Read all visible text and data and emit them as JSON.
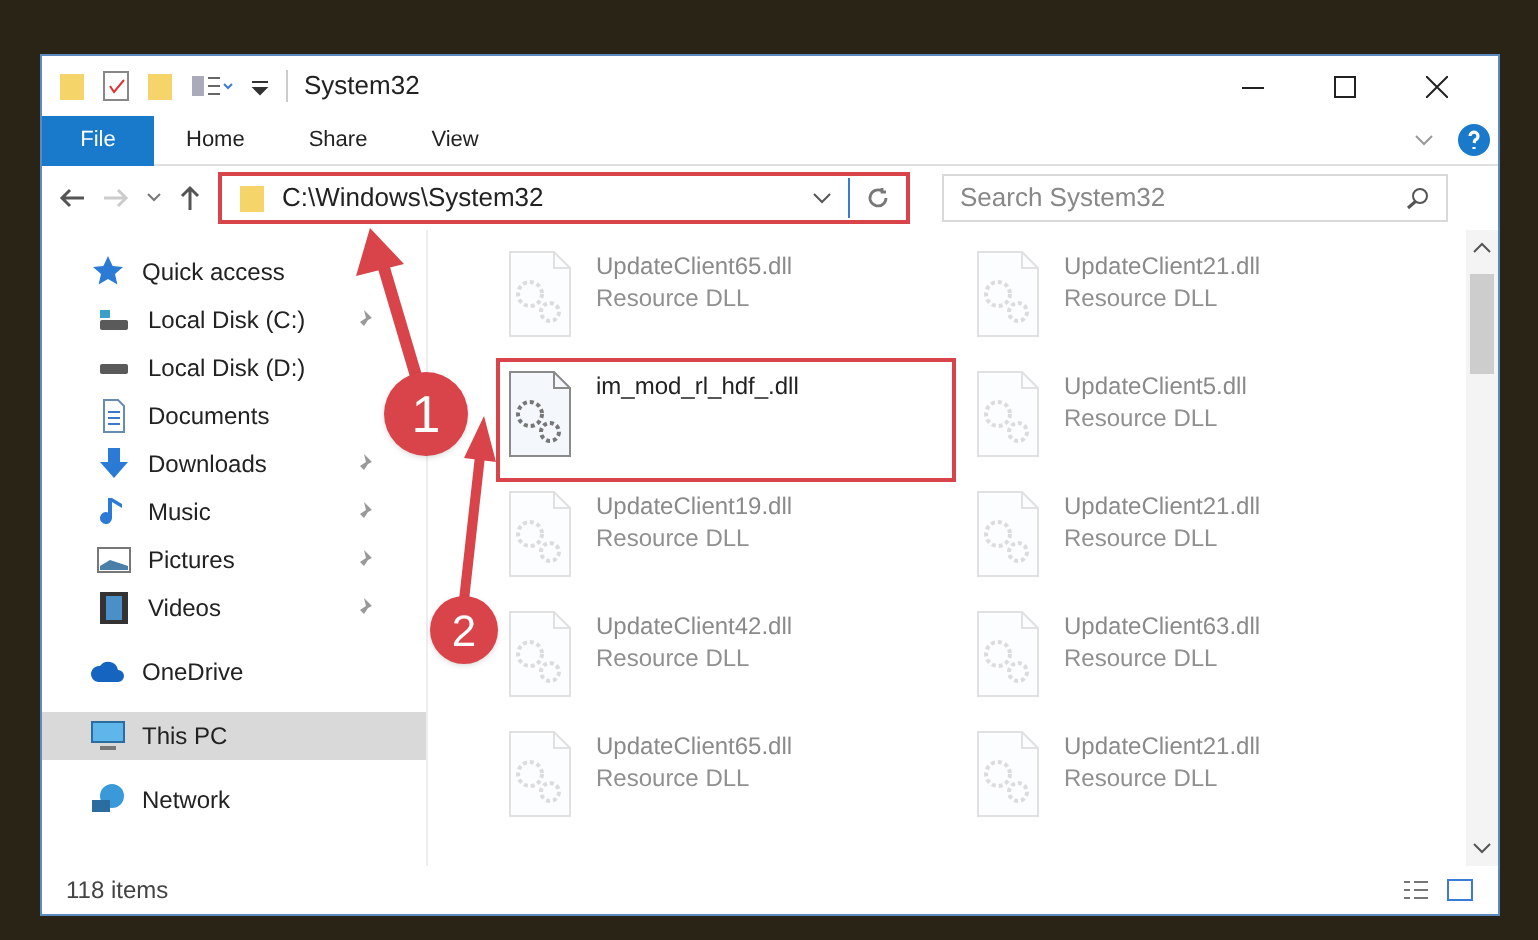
{
  "window": {
    "title": "System32"
  },
  "ribbon_tabs": [
    {
      "label": "File",
      "selected": true
    },
    {
      "label": "Home",
      "selected": false
    },
    {
      "label": "Share",
      "selected": false
    },
    {
      "label": "View",
      "selected": false
    }
  ],
  "address": {
    "path": "C:\\Windows\\System32",
    "highlighted": true
  },
  "search": {
    "placeholder": "Search System32"
  },
  "nav": [
    {
      "label": "Quick access",
      "kind": "star",
      "selected": false,
      "children": [
        {
          "label": "Local Disk (C:)",
          "kind": "drive-c",
          "pinned": true,
          "selected": false
        },
        {
          "label": "Local Disk (D:)",
          "kind": "drive",
          "pinned": false,
          "selected": false
        },
        {
          "label": "Documents",
          "kind": "documents",
          "pinned": false,
          "selected": false
        },
        {
          "label": "Downloads",
          "kind": "downloads",
          "pinned": true,
          "selected": false
        },
        {
          "label": "Music",
          "kind": "music",
          "pinned": true,
          "selected": false
        },
        {
          "label": "Pictures",
          "kind": "pictures",
          "pinned": true,
          "selected": false
        },
        {
          "label": "Videos",
          "kind": "videos",
          "pinned": true,
          "selected": false
        }
      ]
    },
    {
      "label": "OneDrive",
      "kind": "cloud",
      "selected": false
    },
    {
      "label": "This PC",
      "kind": "pc",
      "selected": true
    },
    {
      "label": "Network",
      "kind": "network",
      "selected": false
    }
  ],
  "files": [
    {
      "name": "UpdateClient65.dll",
      "type": "Resource DLL",
      "faded": true,
      "highlighted": false
    },
    {
      "name": "UpdateClient21.dll",
      "type": "Resource DLL",
      "faded": true,
      "highlighted": false
    },
    {
      "name": "im_mod_rl_hdf_.dll",
      "faded": false,
      "highlighted": true
    },
    {
      "name": "UpdateClient5.dll",
      "type": "Resource DLL",
      "faded": true,
      "highlighted": false
    },
    {
      "name": "UpdateClient19.dll",
      "type": "Resource DLL",
      "faded": true,
      "highlighted": false
    },
    {
      "name": "UpdateClient21.dll",
      "type": "Resource DLL",
      "faded": true,
      "highlighted": false
    },
    {
      "name": "UpdateClient42.dll",
      "type": "Resource DLL",
      "faded": true,
      "highlighted": false
    },
    {
      "name": "UpdateClient63.dll",
      "type": "Resource DLL",
      "faded": true,
      "highlighted": false
    },
    {
      "name": "UpdateClient65.dll",
      "type": "Resource DLL",
      "faded": true,
      "highlighted": false
    },
    {
      "name": "UpdateClient21.dll",
      "type": "Resource DLL",
      "faded": true,
      "highlighted": false
    }
  ],
  "status_bar": {
    "count": "118 items"
  },
  "callouts": [
    {
      "number": "1"
    },
    {
      "number": "2"
    }
  ]
}
